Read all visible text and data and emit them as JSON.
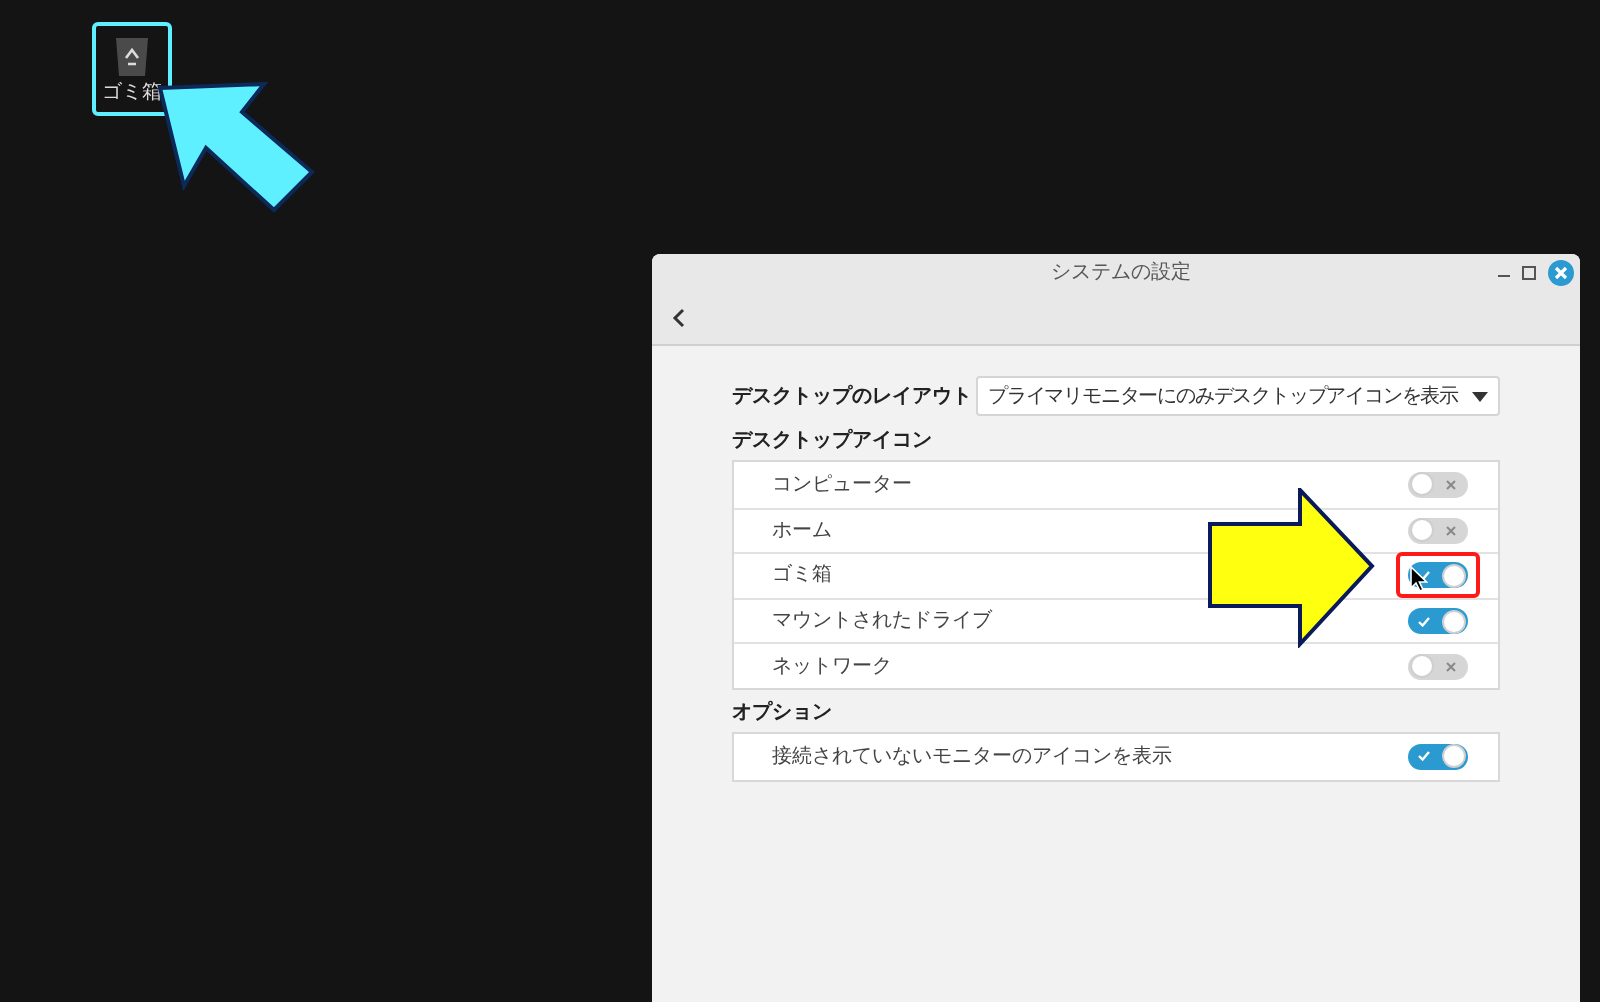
{
  "desktop_icon": {
    "label": "ゴミ箱",
    "highlighted": true
  },
  "window": {
    "title": "システムの設定"
  },
  "layout": {
    "label": "デスクトップのレイアウト",
    "value": "プライマリモニターにのみデスクトップアイコンを表示"
  },
  "sections": [
    {
      "title": "デスクトップアイコン",
      "rows": [
        {
          "label": "コンピューター",
          "on": false,
          "highlighted": false
        },
        {
          "label": "ホーム",
          "on": false,
          "highlighted": false
        },
        {
          "label": "ゴミ箱",
          "on": true,
          "highlighted": true
        },
        {
          "label": "マウントされたドライブ",
          "on": true,
          "highlighted": false
        },
        {
          "label": "ネットワーク",
          "on": false,
          "highlighted": false
        }
      ]
    },
    {
      "title": "オプション",
      "rows": [
        {
          "label": "接続されていないモニターのアイコンを表示",
          "on": true,
          "highlighted": false
        }
      ]
    }
  ]
}
